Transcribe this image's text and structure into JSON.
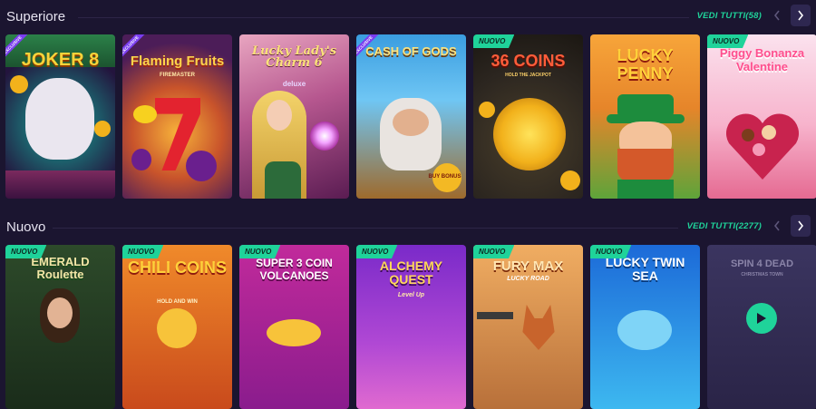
{
  "sections": [
    {
      "title": "Superiore",
      "see_all": "VEDI TUTTI(58)",
      "games": [
        {
          "name": "JOKER 8",
          "sub": "",
          "badge": "EXCLUSIVE"
        },
        {
          "name": "Flaming Fruits",
          "sub": "FIREMASTER",
          "badge": "EXCLUSIVE"
        },
        {
          "name": "Lucky Lady's Charm 6",
          "sub": "deluxe",
          "badge": ""
        },
        {
          "name": "CASH OF GODS",
          "sub": "BUY BONUS",
          "badge": "EXCLUSIVE"
        },
        {
          "name": "36 COINS",
          "sub": "HOLD THE JACKPOT",
          "badge": "NUOVO"
        },
        {
          "name": "LUCKY PENNY",
          "sub": "",
          "badge": ""
        },
        {
          "name": "Piggy Bonanza Valentine",
          "sub": "",
          "badge": "NUOVO"
        }
      ]
    },
    {
      "title": "Nuovo",
      "see_all": "VEDI TUTTI(2277)",
      "games": [
        {
          "name": "EMERALD Roulette",
          "sub": "",
          "badge": "NUOVO"
        },
        {
          "name": "CHILI COINS",
          "sub": "HOLD AND WIN",
          "badge": "NUOVO"
        },
        {
          "name": "SUPER 3 COIN VOLCANOES",
          "sub": "",
          "badge": "NUOVO"
        },
        {
          "name": "ALCHEMY QUEST",
          "sub": "Level Up",
          "badge": "NUOVO"
        },
        {
          "name": "FURY MAX",
          "sub": "LUCKY ROAD",
          "badge": "NUOVO"
        },
        {
          "name": "LUCKY TWIN SEA",
          "sub": "",
          "badge": "NUOVO"
        },
        {
          "name": "SPIN 4 DEAD",
          "sub": "CHRISTMAS TOWN",
          "badge": ""
        }
      ]
    }
  ],
  "colors": {
    "accent": "#1fd39a",
    "background": "#1b1530"
  }
}
